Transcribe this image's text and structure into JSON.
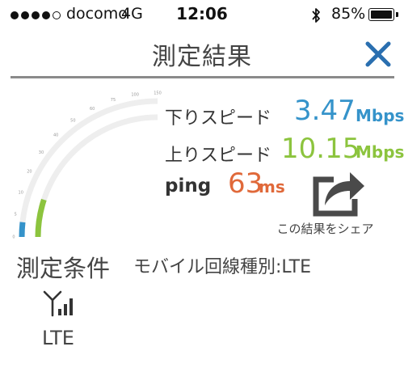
{
  "status_bar": {
    "carrier": "docomo",
    "network": "4G",
    "time": "12:06",
    "battery_percent": "85%",
    "battery_level": 0.85,
    "signal_bars_filled": 4,
    "signal_bars_total": 5
  },
  "header": {
    "title": "測定結果",
    "close_icon": "close-icon",
    "close_color": "#2a6fb0"
  },
  "gauge": {
    "tick_labels": [
      "0",
      "5",
      "10",
      "20",
      "30",
      "40",
      "50",
      "60",
      "75",
      "100",
      "150"
    ],
    "download_value": 3.47,
    "upload_value": 10.15,
    "download_color": "#3593ca",
    "upload_color": "#8cc43e"
  },
  "results": {
    "download": {
      "label": "下りスピード",
      "value": "3.47",
      "unit": "Mbps"
    },
    "upload": {
      "label": "上りスピード",
      "value": "10.15",
      "unit": "Mbps"
    },
    "ping": {
      "label": "ping",
      "value": "63",
      "unit": "ms"
    }
  },
  "share": {
    "label": "この結果をシェア",
    "icon": "share-icon"
  },
  "conditions": {
    "title": "測定条件",
    "mobile_type": "モバイル回線種別:LTE",
    "network_icon": "cell-signal-icon",
    "network_label": "LTE"
  }
}
